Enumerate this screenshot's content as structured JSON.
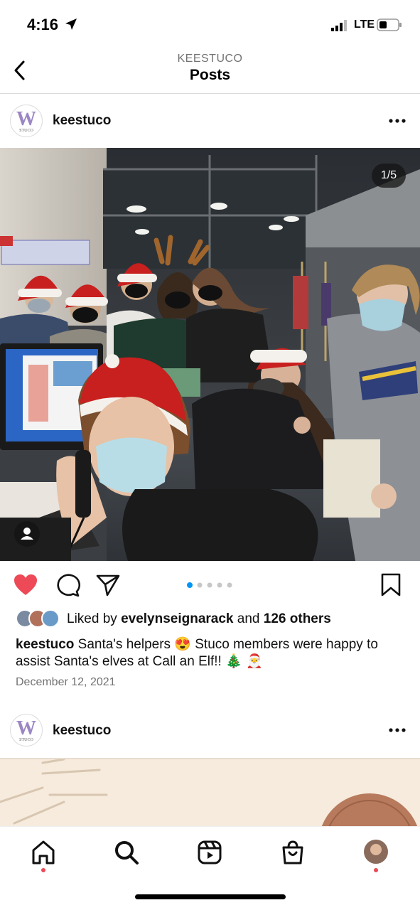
{
  "status": {
    "time": "4:16",
    "network": "LTE"
  },
  "nav": {
    "subtitle": "KEESTUCO",
    "title": "Posts"
  },
  "post": {
    "username": "keestuco",
    "avatar_letter": "W",
    "avatar_caption": "STUCO",
    "photo_counter": "1/5",
    "carousel_pages": 5,
    "carousel_active": 1,
    "liked": true,
    "liked_by": "Liked by",
    "liked_user": "evelynseignarack",
    "liked_and": "and",
    "liked_others": "126 others",
    "caption_user": "keestuco",
    "caption_text": "Santa's helpers 😍 Stuco members were happy to assist Santa's elves at Call an Elf!! 🎄 🎅",
    "date": "December 12, 2021"
  },
  "next_post": {
    "username": "keestuco",
    "avatar_letter": "W",
    "avatar_caption": "STUCO"
  },
  "tabs": [
    {
      "name": "home",
      "icon": "home-icon",
      "active_dot": true
    },
    {
      "name": "search",
      "icon": "search-icon",
      "active_dot": false
    },
    {
      "name": "reels",
      "icon": "reels-icon",
      "active_dot": false
    },
    {
      "name": "shop",
      "icon": "shop-icon",
      "active_dot": false
    },
    {
      "name": "profile",
      "icon": "profile-avatar",
      "active_dot": true
    }
  ],
  "colors": {
    "like": "#ed4956",
    "carousel_active": "#0095f6",
    "carousel_inactive": "#c7c7c7",
    "muted": "#737373"
  }
}
